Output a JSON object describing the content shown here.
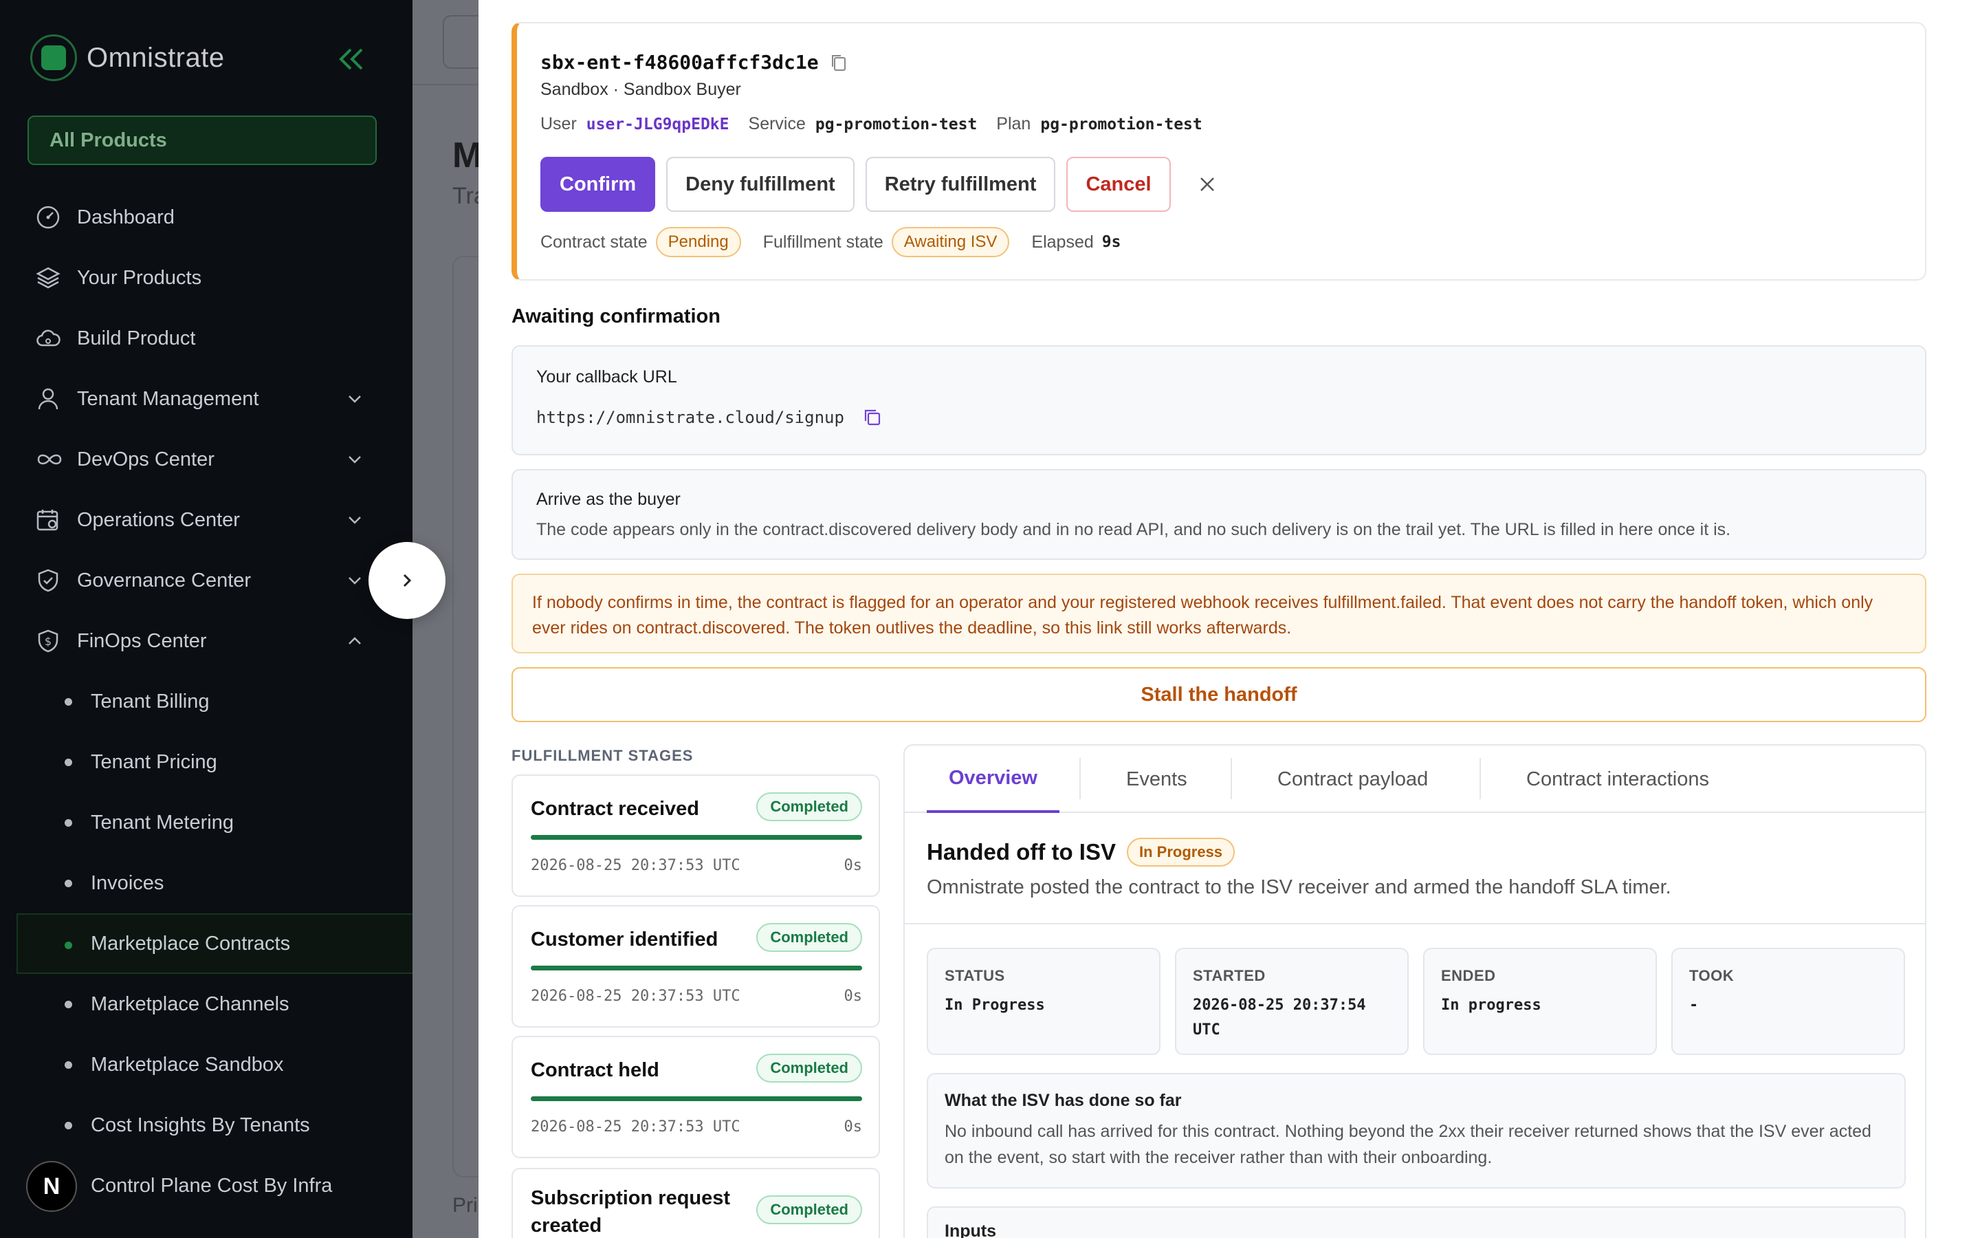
{
  "brand": {
    "name": "Omnistrate"
  },
  "sidebar": {
    "all_products": "All Products",
    "items": [
      {
        "label": "Dashboard",
        "icon": "gauge-icon"
      },
      {
        "label": "Your Products",
        "icon": "layers-icon"
      },
      {
        "label": "Build Product",
        "icon": "cloud-icon"
      },
      {
        "label": "Tenant Management",
        "icon": "user-icon",
        "expandable": true
      },
      {
        "label": "DevOps Center",
        "icon": "infinity-icon",
        "expandable": true
      },
      {
        "label": "Operations Center",
        "icon": "calendar-gear-icon",
        "expandable": true
      },
      {
        "label": "Governance Center",
        "icon": "shield-check-icon",
        "expandable": true
      },
      {
        "label": "FinOps Center",
        "icon": "shield-dollar-icon",
        "expandable": true,
        "expanded": true
      }
    ],
    "finops_items": [
      "Tenant Billing",
      "Tenant Pricing",
      "Tenant Metering",
      "Invoices",
      "Marketplace Contracts",
      "Marketplace Channels",
      "Marketplace Sandbox",
      "Cost Insights By Tenants",
      "Control Plane Cost By Infra"
    ],
    "active_item": "Marketplace Contracts",
    "avatar_initial": "N"
  },
  "background": {
    "title": "M",
    "subtitle": "Tra",
    "footer": "Pri"
  },
  "contract": {
    "id": "sbx-ent-f48600affcf3dc1e",
    "environment": "Sandbox · Sandbox Buyer",
    "user_label": "User",
    "user_value": "user-JLG9qpEDkE",
    "service_label": "Service",
    "service_value": "pg-promotion-test",
    "plan_label": "Plan",
    "plan_value": "pg-promotion-test",
    "actions": {
      "confirm": "Confirm",
      "deny": "Deny fulfillment",
      "retry": "Retry fulfillment",
      "cancel": "Cancel"
    },
    "contract_state_label": "Contract state",
    "contract_state": "Pending",
    "fulfillment_state_label": "Fulfillment state",
    "fulfillment_state": "Awaiting ISV",
    "elapsed_label": "Elapsed",
    "elapsed": "9s"
  },
  "awaiting": {
    "title": "Awaiting confirmation",
    "callback_label": "Your callback URL",
    "callback_url": "https://omnistrate.cloud/signup",
    "arrive_label": "Arrive as the buyer",
    "arrive_desc": "The code appears only in the contract.discovered delivery body and in no read API, and no such delivery is on the trail yet. The URL is filled in here once it is.",
    "warning": "If nobody confirms in time, the contract is flagged for an operator and your registered webhook receives fulfillment.failed. That event does not carry the handoff token, which only ever rides on contract.discovered. The token outlives the deadline, so this link still works afterwards.",
    "stall_button": "Stall the handoff"
  },
  "stages": {
    "title": "FULFILLMENT STAGES",
    "items": [
      {
        "name": "Contract received",
        "status": "Completed",
        "progress": 1.0,
        "timestamp": "2026-08-25 20:37:53 UTC",
        "duration": "0s"
      },
      {
        "name": "Customer identified",
        "status": "Completed",
        "progress": 1.0,
        "timestamp": "2026-08-25 20:37:53 UTC",
        "duration": "0s"
      },
      {
        "name": "Contract held",
        "status": "Completed",
        "progress": 1.0,
        "timestamp": "2026-08-25 20:37:53 UTC",
        "duration": "0s"
      },
      {
        "name": "Subscription request created",
        "status": "Completed",
        "progress": 1.0,
        "timestamp": "",
        "duration": ""
      }
    ]
  },
  "detail": {
    "tabs": [
      "Overview",
      "Events",
      "Contract payload",
      "Contract interactions"
    ],
    "active_tab": "Overview",
    "title": "Handed off to ISV",
    "status_badge": "In Progress",
    "description": "Omnistrate posted the contract to the ISV receiver and armed the handoff SLA timer.",
    "stats": [
      {
        "label": "STATUS",
        "value": "In Progress"
      },
      {
        "label": "STARTED",
        "value": "2026-08-25 20:37:54 UTC"
      },
      {
        "label": "ENDED",
        "value": "In progress"
      },
      {
        "label": "TOOK",
        "value": "-"
      }
    ],
    "so_far_label": "What the ISV has done so far",
    "so_far_text": "No inbound call has arrived for this contract. Nothing beyond the 2xx their receiver returned shows that the ISV ever acted on the event, so start with the receiver rather than with their onboarding.",
    "inputs_label": "Inputs"
  },
  "colors": {
    "accent": "#6f44d6",
    "brand_green": "#1e8a47",
    "warning_border": "#f29b2d",
    "completed_green": "#1a7a44"
  }
}
